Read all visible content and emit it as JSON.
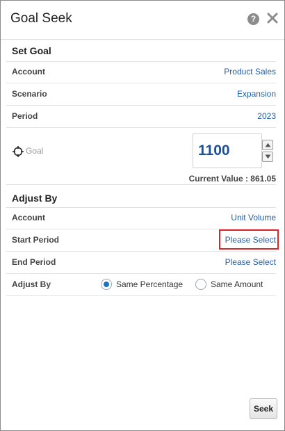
{
  "header": {
    "title": "Goal Seek",
    "help_icon": "question-circle-icon",
    "help_glyph": "?",
    "close_icon": "close-icon"
  },
  "set_goal": {
    "title": "Set Goal",
    "rows": [
      {
        "label": "Account",
        "value": "Product Sales"
      },
      {
        "label": "Scenario",
        "value": "Expansion"
      },
      {
        "label": "Period",
        "value": "2023"
      }
    ],
    "goal_label": "Goal",
    "goal_icon": "target-icon",
    "goal_value": "1100",
    "current_value": "Current Value : 861.05"
  },
  "adjust_by": {
    "title": "Adjust By",
    "rows": [
      {
        "label": "Account",
        "value": "Unit Volume"
      },
      {
        "label": "Start Period",
        "value": "Please Select"
      },
      {
        "label": "End Period",
        "value": "Please Select"
      }
    ],
    "mode_label": "Adjust By",
    "options": [
      {
        "label": "Same Percentage",
        "selected": true
      },
      {
        "label": "Same Amount",
        "selected": false
      }
    ]
  },
  "footer": {
    "seek_label": "Seek"
  },
  "colors": {
    "link": "#1f5ea8",
    "goal_value": "#1f4f96",
    "highlight": "#d9262b",
    "radio_selected": "#1a73c8"
  }
}
